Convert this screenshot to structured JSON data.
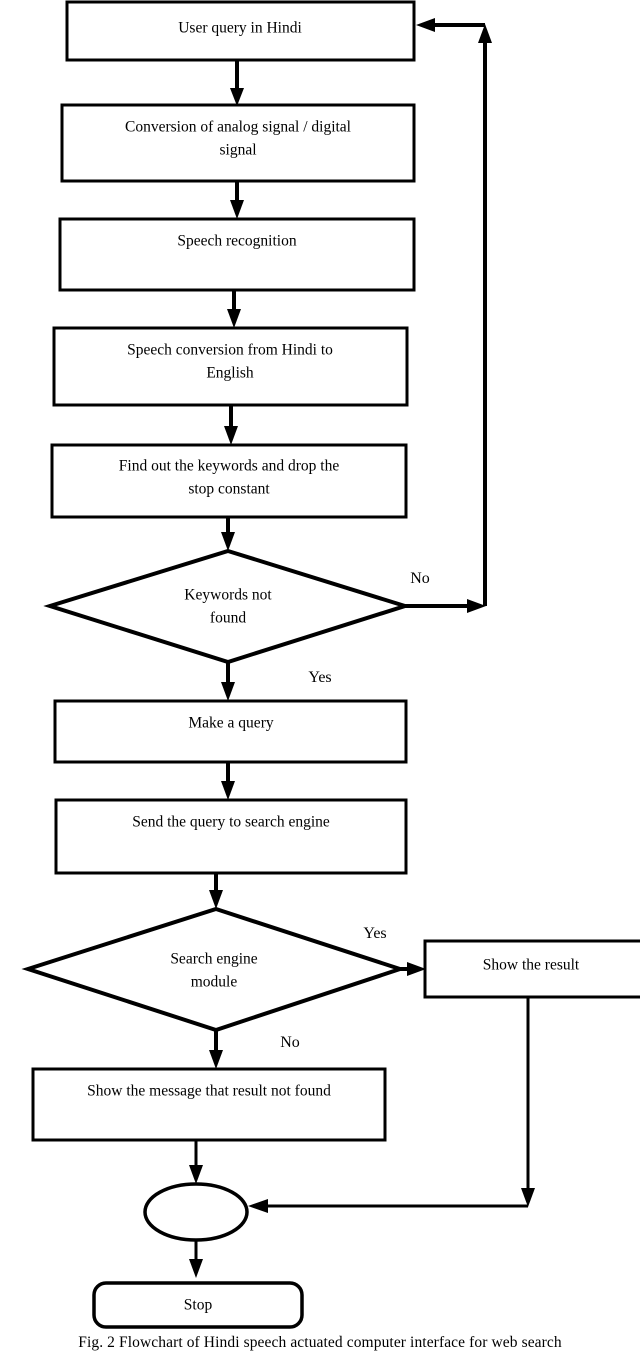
{
  "figure": {
    "caption": "Fig. 2 Flowchart of Hindi speech actuated computer interface for web search"
  },
  "colors": {
    "stroke": "#000000",
    "fill": "#ffffff",
    "text": "#000000"
  },
  "chart_data": {
    "type": "diagram",
    "title": "Fig. 2 Flowchart of Hindi speech actuated computer interface for web search",
    "nodes": [
      {
        "id": "n1",
        "shape": "process",
        "label": "User query in Hindi"
      },
      {
        "id": "n2",
        "shape": "process",
        "label_line1": "Conversion of analog signal / digital",
        "label_line2": "signal"
      },
      {
        "id": "n3",
        "shape": "process",
        "label": "Speech recognition"
      },
      {
        "id": "n4",
        "shape": "process",
        "label_line1": "Speech conversion from Hindi to",
        "label_line2": "English"
      },
      {
        "id": "n5",
        "shape": "process",
        "label_line1": "Find out the keywords and drop the",
        "label_line2": "stop constant"
      },
      {
        "id": "d1",
        "shape": "decision",
        "label_line1": "Keywords not",
        "label_line2": "found"
      },
      {
        "id": "n6",
        "shape": "process",
        "label": "Make a query"
      },
      {
        "id": "n7",
        "shape": "process",
        "label": "Send the query to search engine"
      },
      {
        "id": "d2",
        "shape": "decision",
        "label_line1": "Search engine",
        "label_line2": "module"
      },
      {
        "id": "n8",
        "shape": "process",
        "label": "Show the result"
      },
      {
        "id": "n9",
        "shape": "process",
        "label": "Show the message that result not found"
      },
      {
        "id": "n10",
        "shape": "connector",
        "label": ""
      },
      {
        "id": "n11",
        "shape": "terminator",
        "label": "Stop"
      }
    ],
    "edges": [
      {
        "from": "n1",
        "to": "n2",
        "label": ""
      },
      {
        "from": "n2",
        "to": "n3",
        "label": ""
      },
      {
        "from": "n3",
        "to": "n4",
        "label": ""
      },
      {
        "from": "n4",
        "to": "n5",
        "label": ""
      },
      {
        "from": "n5",
        "to": "d1",
        "label": ""
      },
      {
        "from": "d1",
        "to": "n1",
        "label": "No"
      },
      {
        "from": "d1",
        "to": "n6",
        "label": "Yes"
      },
      {
        "from": "n6",
        "to": "n7",
        "label": ""
      },
      {
        "from": "n7",
        "to": "d2",
        "label": ""
      },
      {
        "from": "d2",
        "to": "n8",
        "label": "Yes"
      },
      {
        "from": "d2",
        "to": "n9",
        "label": "No"
      },
      {
        "from": "n9",
        "to": "n10",
        "label": ""
      },
      {
        "from": "n8",
        "to": "n10",
        "label": ""
      },
      {
        "from": "n10",
        "to": "n11",
        "label": ""
      }
    ],
    "edge_labels": {
      "keywords_no": "No",
      "keywords_yes": "Yes",
      "search_yes": "Yes",
      "search_no": "No"
    }
  }
}
